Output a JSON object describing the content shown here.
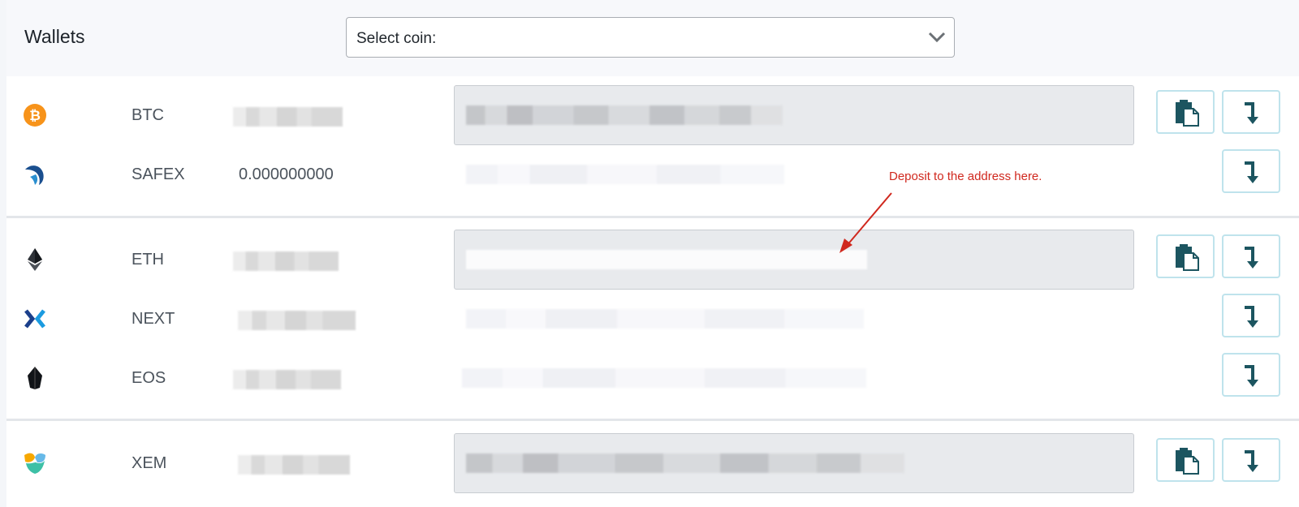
{
  "header": {
    "title": "Wallets"
  },
  "coin_select": {
    "label": "Select coin:",
    "icon": "chevron-down-icon"
  },
  "annotation": {
    "text": "Deposit to the address here.",
    "color": "#d0281e"
  },
  "buttons": {
    "copy_icon": "copy-document-icon",
    "deposit_icon": "deposit-arrow-icon"
  },
  "wallets": [
    {
      "ticker": "BTC",
      "balance": "",
      "address_visible": false,
      "has_copy": true
    },
    {
      "ticker": "SAFEX",
      "balance": "0.000000000",
      "address_visible": false,
      "has_copy": false
    },
    {
      "ticker": "ETH",
      "balance": "",
      "address_visible": false,
      "has_copy": true
    },
    {
      "ticker": "NEXT",
      "balance": "",
      "address_visible": false,
      "has_copy": false
    },
    {
      "ticker": "EOS",
      "balance": "",
      "address_visible": false,
      "has_copy": false
    },
    {
      "ticker": "XEM",
      "balance": "",
      "address_visible": false,
      "has_copy": true
    }
  ],
  "colors": {
    "btc": "#f7931a",
    "safex": "#1a4f8f",
    "next": "#1b5fb6",
    "button_border": "#bfe3ec",
    "button_icon": "#1c5560"
  }
}
